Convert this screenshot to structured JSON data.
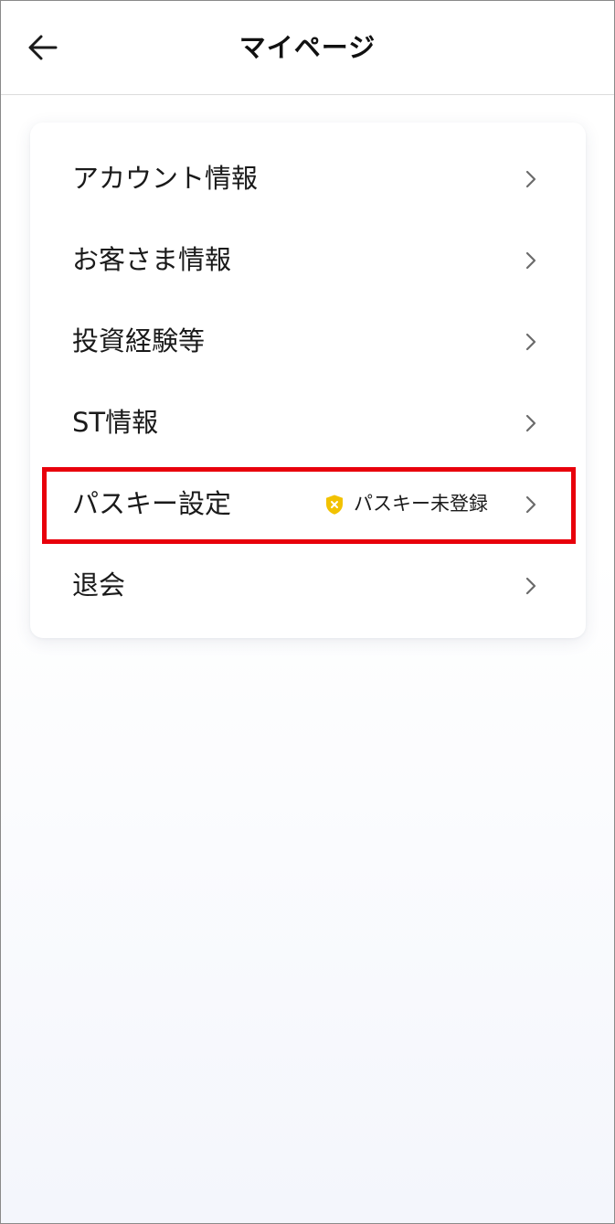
{
  "header": {
    "title": "マイページ",
    "back_icon": "arrow-left-icon"
  },
  "menu": {
    "items": [
      {
        "label": "アカウント情報"
      },
      {
        "label": "お客さま情報"
      },
      {
        "label": "投資経験等"
      },
      {
        "label": "ST情報"
      },
      {
        "label": "パスキー設定",
        "status_text": "パスキー未登録",
        "status_icon": "shield-x-icon"
      },
      {
        "label": "退会"
      }
    ]
  },
  "colors": {
    "highlight": "#e8000b",
    "status_icon": "#f2c200",
    "chevron": "#6b6b6b"
  }
}
